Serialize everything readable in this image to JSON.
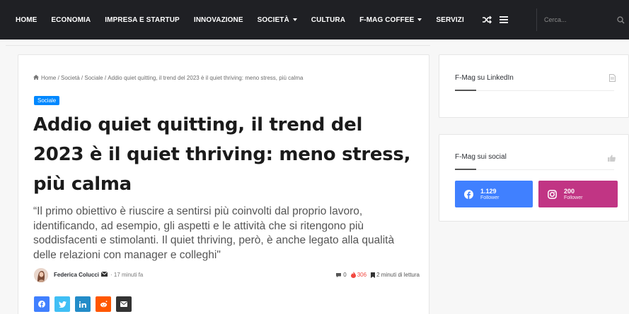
{
  "nav": {
    "items": [
      {
        "label": "HOME",
        "dropdown": false
      },
      {
        "label": "ECONOMIA",
        "dropdown": false
      },
      {
        "label": "IMPRESA E STARTUP",
        "dropdown": false
      },
      {
        "label": "INNOVAZIONE",
        "dropdown": false
      },
      {
        "label": "SOCIETÀ",
        "dropdown": true
      },
      {
        "label": "CULTURA",
        "dropdown": false
      },
      {
        "label": "F-MAG COFFEE",
        "dropdown": true
      },
      {
        "label": "SERVIZI",
        "dropdown": false
      }
    ],
    "icons": [
      "shuffle-icon",
      "menu-icon",
      "moon-icon"
    ],
    "search_placeholder": "Cerca..."
  },
  "article": {
    "breadcrumb": {
      "home": "Home",
      "sep": " / ",
      "items": [
        "Società",
        "Sociale",
        "Addio quiet quitting, il trend del 2023 è il quiet thriving: meno stress, più calma"
      ]
    },
    "category": "Sociale",
    "title": "Addio quiet quitting, il trend del 2023 è il quiet thriving: meno stress, più calma",
    "excerpt": "“Il primo obiettivo è riuscire a sentirsi più coinvolti dal proprio lavoro, identificando, ad esempio, gli aspetti e le attività che si ritengono più soddisfacenti e stimolanti. Il quiet thriving, però, è anche legato alla qualità delle relazioni con manager e colleghi\"",
    "author": "Federica Colucci",
    "time": "· 17 minuti fa",
    "comments": "0",
    "views": "306",
    "reading_time": "2 minuti di lettura",
    "share_buttons": [
      {
        "icon": "facebook-icon",
        "color": "#4080ff"
      },
      {
        "icon": "twitter-icon",
        "color": "#40bff5"
      },
      {
        "icon": "linkedin-icon",
        "color": "#238cc8"
      },
      {
        "icon": "reddit-icon",
        "color": "#ff5700"
      },
      {
        "icon": "email-icon",
        "color": "#333333"
      }
    ]
  },
  "sidebar": {
    "linkedin_widget": {
      "title": "F-Mag su LinkedIn",
      "icon": "document-icon"
    },
    "social_widget": {
      "title": "F-Mag sui social",
      "icon": "thumbs-up-icon",
      "facebook": {
        "count": "1.129",
        "label": "Follower",
        "color": "#4080ff"
      },
      "instagram": {
        "count": "200",
        "label": "Follower",
        "color": "#c13584"
      }
    }
  },
  "colors": {
    "topbar": "#1f2024",
    "accent": "#0088ff"
  }
}
